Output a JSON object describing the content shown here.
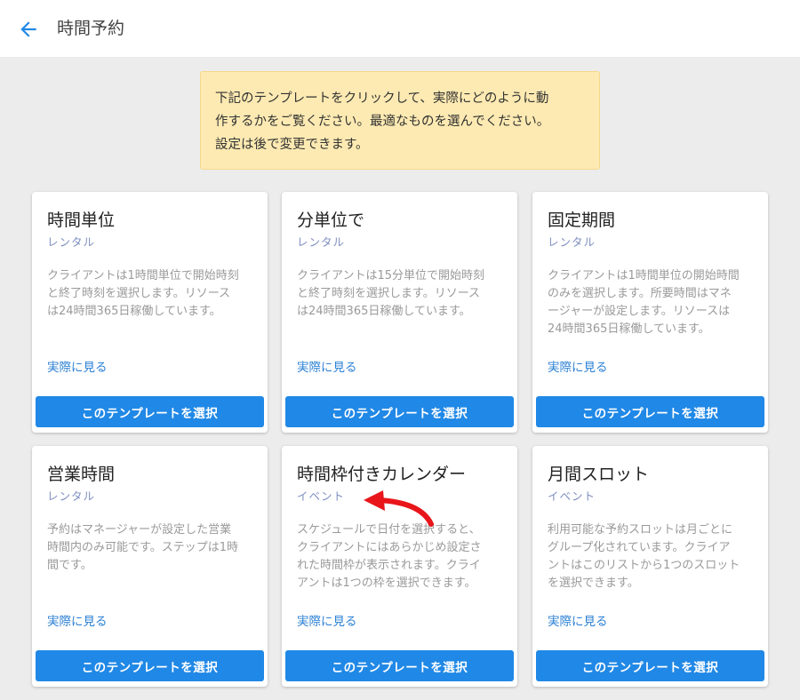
{
  "header": {
    "title": "時間予約"
  },
  "notice": {
    "lines": [
      "下記のテンプレートをクリックして、実際にどのように動",
      "作するかをご覧ください。最適なものを選んでください。",
      "設定は後で変更できます。"
    ]
  },
  "cards": [
    {
      "title": "時間単位",
      "subtitle": "レンタル",
      "desc_lines": [
        "クライアントは1時間単位で開始時刻",
        "と終了時刻を選択します。リソース",
        "は24時間365日稼働しています。"
      ],
      "link": "実際に見る",
      "button": "このテンプレートを選択"
    },
    {
      "title": "分単位で",
      "subtitle": "レンタル",
      "desc_lines": [
        "クライアントは15分単位で開始時刻",
        "と終了時刻を選択します。リソース",
        "は24時間365日稼働しています。"
      ],
      "link": "実際に見る",
      "button": "このテンプレートを選択"
    },
    {
      "title": "固定期間",
      "subtitle": "レンタル",
      "desc_lines": [
        "クライアントは1時間単位の開始時間",
        "のみを選択します。所要時間はマネ",
        "ージャーが設定します。リソースは",
        "24時間365日稼働しています。"
      ],
      "link": "実際に見る",
      "button": "このテンプレートを選択"
    },
    {
      "title": "営業時間",
      "subtitle": "レンタル",
      "desc_lines": [
        "予約はマネージャーが設定した営業",
        "時間内のみ可能です。ステップは1時",
        "間です。"
      ],
      "link": "実際に見る",
      "button": "このテンプレートを選択"
    },
    {
      "title": "時間枠付きカレンダー",
      "subtitle": "イベント",
      "desc_lines": [
        "スケジュールで日付を選択すると、",
        "クライアントにはあらかじめ設定さ",
        "れた時間枠が表示されます。クライ",
        "アントは1つの枠を選択できます。"
      ],
      "link": "実際に見る",
      "button": "このテンプレートを選択"
    },
    {
      "title": "月間スロット",
      "subtitle": "イベント",
      "desc_lines": [
        "利用可能な予約スロットは月ごとに",
        "グループ化されています。クライア",
        "ントはこのリストから1つのスロット",
        "を選択できます。"
      ],
      "link": "実際に見る",
      "button": "このテンプレートを選択"
    }
  ],
  "colors": {
    "accent": "#2088e6",
    "link": "#2a7fd4",
    "notice_bg": "#fdeab2",
    "annotation_arrow": "#e8161b"
  }
}
